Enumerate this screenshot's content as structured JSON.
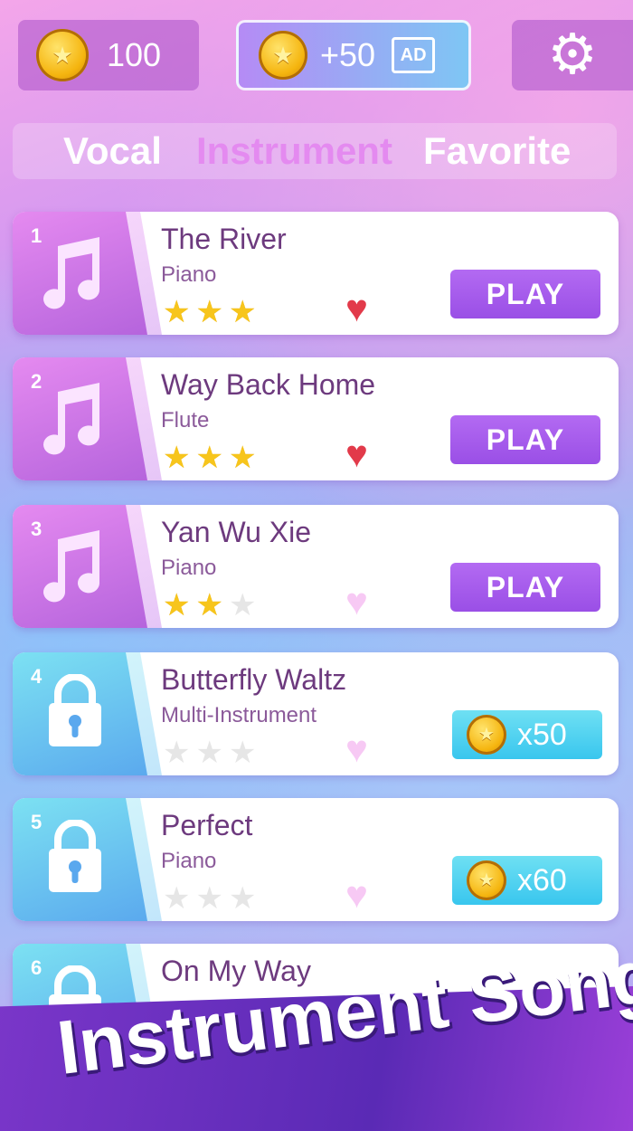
{
  "header": {
    "coins": "100",
    "ad_reward": "+50",
    "ad_label": "AD",
    "settings_icon": "gear-icon"
  },
  "tabs": [
    "Vocal",
    "Instrument",
    "Favorite"
  ],
  "active_tab": "Instrument",
  "songs": [
    {
      "number": "1",
      "title": "The River",
      "instrument": "Piano",
      "stars": 3,
      "favorite": true,
      "locked": false,
      "action": "PLAY"
    },
    {
      "number": "2",
      "title": "Way Back Home",
      "instrument": "Flute",
      "stars": 3,
      "favorite": true,
      "locked": false,
      "action": "PLAY"
    },
    {
      "number": "3",
      "title": "Yan Wu Xie",
      "instrument": "Piano",
      "stars": 2,
      "favorite": false,
      "locked": false,
      "action": "PLAY"
    },
    {
      "number": "4",
      "title": "Butterfly Waltz",
      "instrument": "Multi-Instrument",
      "stars": 0,
      "favorite": false,
      "locked": true,
      "price": "x50"
    },
    {
      "number": "5",
      "title": "Perfect",
      "instrument": "Piano",
      "stars": 0,
      "favorite": false,
      "locked": true,
      "price": "x60"
    },
    {
      "number": "6",
      "title": "On My Way",
      "locked": true
    }
  ],
  "banner": "Instrument Songs",
  "colors": {
    "play_button": "#a85cee",
    "price_button": "#4fcff0",
    "star_on": "#f7c51c",
    "heart_on": "#e23a4a",
    "heart_off": "#f7c9f4"
  }
}
